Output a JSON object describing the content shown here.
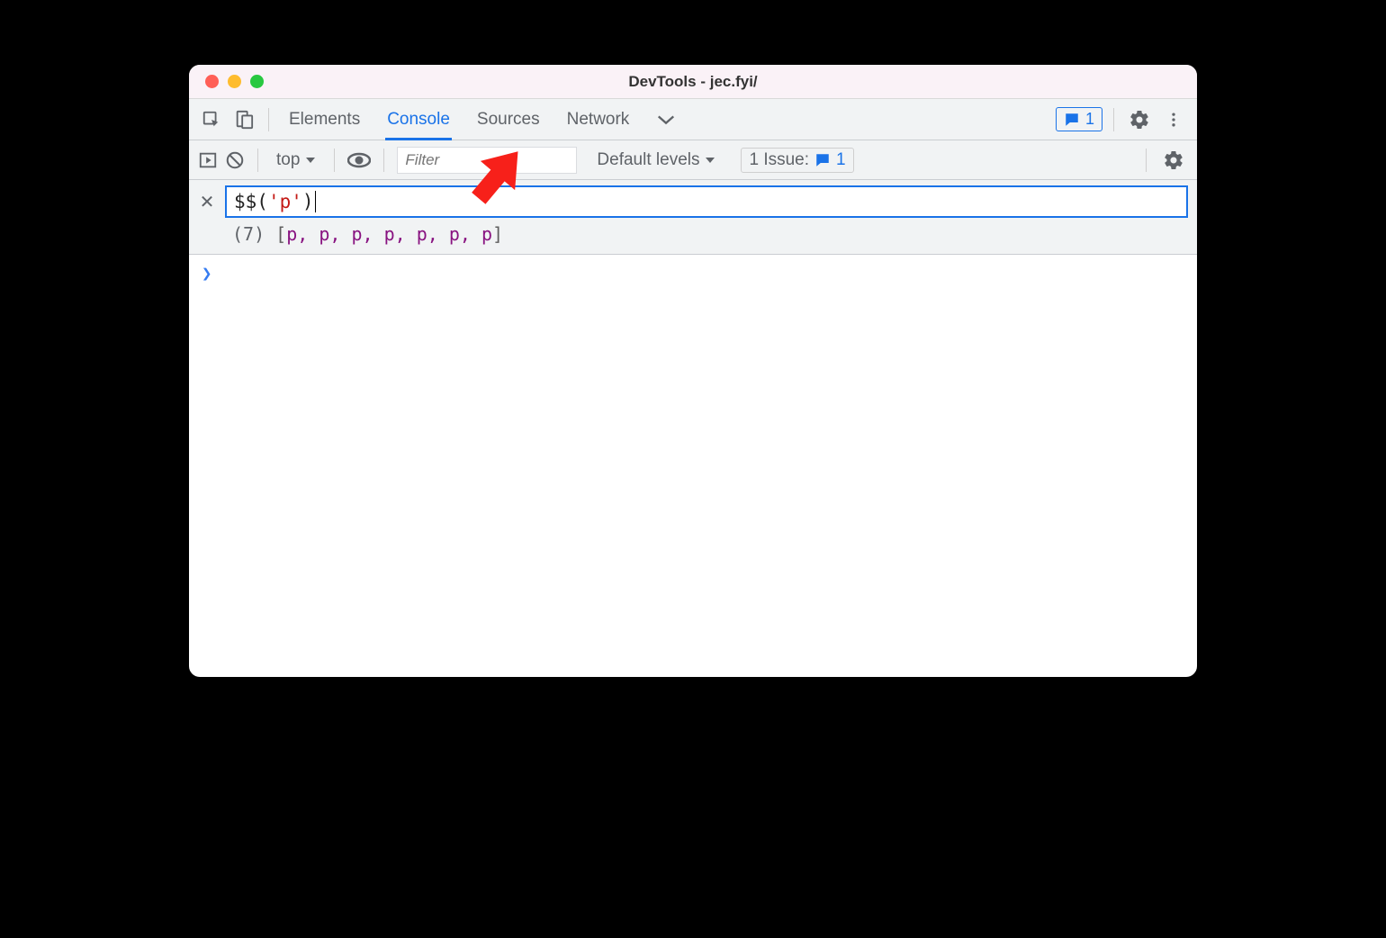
{
  "window": {
    "title": "DevTools - jec.fyi/"
  },
  "tabs": {
    "elements": "Elements",
    "console": "Console",
    "sources": "Sources",
    "network": "Network"
  },
  "badges": {
    "feedback_count": "1"
  },
  "subbar": {
    "context": "top",
    "filter_placeholder": "Filter",
    "levels_label": "Default levels",
    "issues_label": "1 Issue:",
    "issues_count": "1"
  },
  "eval": {
    "expr_fn_open": "$$(",
    "expr_str": "'p'",
    "expr_fn_close": ")",
    "result_count": "(7)",
    "result_open": "[",
    "result_items": "p, p, p, p, p, p, p",
    "result_close": "]"
  },
  "prompt": {
    "chevron": "❯"
  }
}
